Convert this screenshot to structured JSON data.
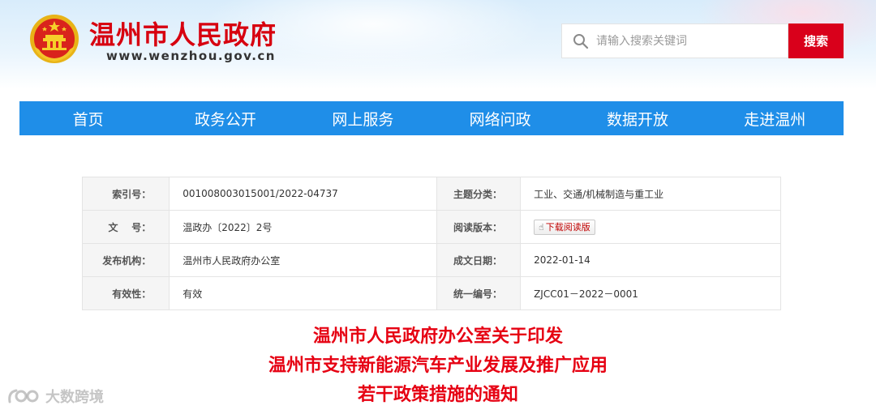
{
  "header": {
    "site_title": "温州市人民政府",
    "site_domain": "www.wenzhou.gov.cn",
    "emblem_icon": "national-emblem-icon",
    "search": {
      "placeholder": "请输入搜索关键词",
      "value": "",
      "button_label": "搜索",
      "icon": "search-icon"
    }
  },
  "nav": {
    "items": [
      {
        "label": "首页"
      },
      {
        "label": "政务公开"
      },
      {
        "label": "网上服务"
      },
      {
        "label": "网络问政"
      },
      {
        "label": "数据开放"
      },
      {
        "label": "走进温州"
      }
    ]
  },
  "meta": {
    "index_label": "索引号：",
    "index_value": "001008003015001/2022-04737",
    "topic_label": "主题分类：",
    "topic_value": "工业、交通/机械制造与重工业",
    "doc_no_label": "文    号：",
    "doc_no_value": "温政办〔2022〕2号",
    "reading_label": "阅读版本：",
    "reading_button": "下载阅读版",
    "issuer_label": "发布机构：",
    "issuer_value": "温州市人民政府办公室",
    "date_label": "成文日期：",
    "date_value": "2022-01-14",
    "validity_label": "有效性：",
    "validity_value": "有效",
    "serial_label": "统一编号：",
    "serial_value": "ZJCC01－2022－0001"
  },
  "document": {
    "title_line1": "温州市人民政府办公室关于印发",
    "title_line2": "温州市支持新能源汽车产业发展及推广应用",
    "title_line3": "若干政策措施的通知"
  },
  "watermark": {
    "text": "大数跨境"
  },
  "colors": {
    "brand_red": "#d7000f",
    "nav_blue": "#1f8ee8",
    "title_red": "#e60012"
  }
}
